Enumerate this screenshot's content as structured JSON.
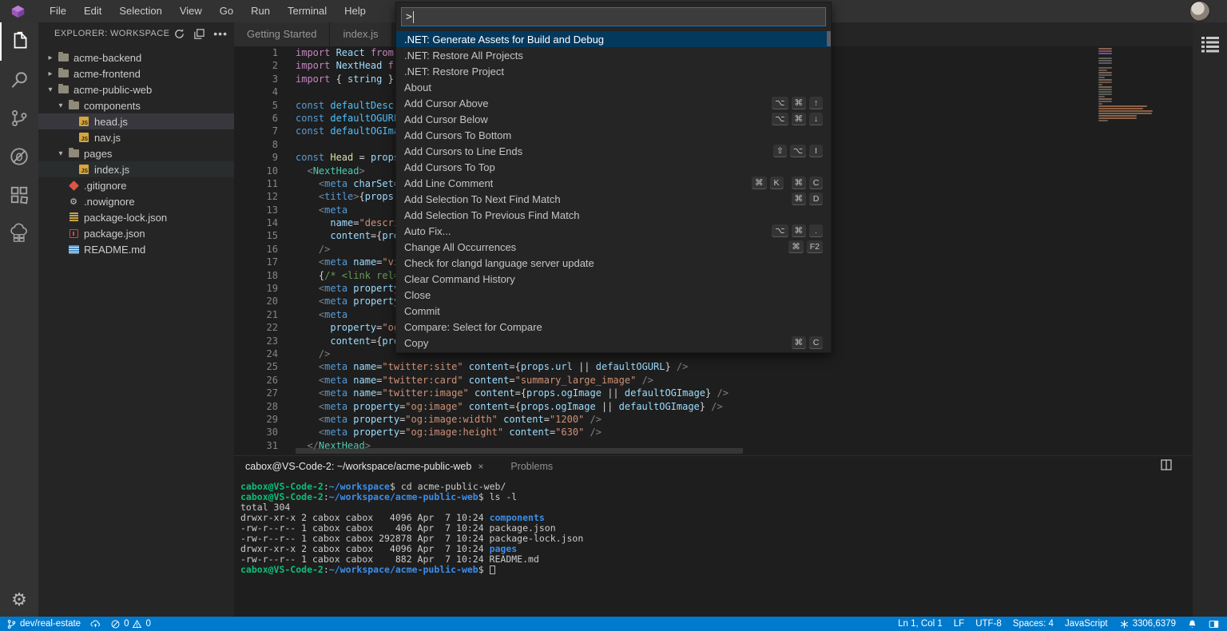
{
  "menu_bar": {
    "items": [
      "File",
      "Edit",
      "Selection",
      "View",
      "Go",
      "Run",
      "Terminal",
      "Help"
    ]
  },
  "activity_bar": {
    "items": [
      "explorer",
      "search",
      "source-control",
      "debug",
      "extensions",
      "remote"
    ],
    "active": "explorer",
    "bottom": "settings"
  },
  "explorer": {
    "header": "EXPLORER: WORKSPACE",
    "tree": [
      {
        "label": "acme-backend",
        "icon": "folder",
        "chevron": ">",
        "indent": 0
      },
      {
        "label": "acme-frontend",
        "icon": "folder",
        "chevron": ">",
        "indent": 0
      },
      {
        "label": "acme-public-web",
        "icon": "folder",
        "chevron": "v",
        "indent": 0
      },
      {
        "label": "components",
        "icon": "folder",
        "chevron": "v",
        "indent": 1
      },
      {
        "label": "head.js",
        "icon": "js",
        "indent": 2,
        "state": "selected"
      },
      {
        "label": "nav.js",
        "icon": "js",
        "indent": 2
      },
      {
        "label": "pages",
        "icon": "folder",
        "chevron": "v",
        "indent": 1
      },
      {
        "label": "index.js",
        "icon": "js",
        "indent": 2,
        "state": "subtle"
      },
      {
        "label": ".gitignore",
        "icon": "git",
        "indent": 1
      },
      {
        "label": ".nowignore",
        "icon": "gear",
        "indent": 1
      },
      {
        "label": "package-lock.json",
        "icon": "lock",
        "indent": 1
      },
      {
        "label": "package.json",
        "icon": "npm",
        "indent": 1
      },
      {
        "label": "README.md",
        "icon": "md",
        "indent": 1
      }
    ]
  },
  "tabs": [
    {
      "label": "Getting Started"
    },
    {
      "label": "index.js"
    }
  ],
  "editor": {
    "lines": [
      {
        "n": "1",
        "t": [
          [
            "kw",
            "import "
          ],
          [
            "id",
            "React "
          ],
          [
            "kw",
            "from "
          ],
          [
            "str",
            "'"
          ]
        ]
      },
      {
        "n": "2",
        "t": [
          [
            "kw",
            "import "
          ],
          [
            "id",
            "NextHead "
          ],
          [
            "kw",
            "fro"
          ]
        ]
      },
      {
        "n": "3",
        "t": [
          [
            "kw",
            "import "
          ],
          [
            "pl",
            "{ "
          ],
          [
            "id",
            "string "
          ],
          [
            "pl",
            "} "
          ],
          [
            "kw",
            "f"
          ]
        ]
      },
      {
        "n": "4",
        "t": []
      },
      {
        "n": "5",
        "t": [
          [
            "blue",
            "const "
          ],
          [
            "id2",
            "defaultDescri"
          ]
        ]
      },
      {
        "n": "6",
        "t": [
          [
            "blue",
            "const "
          ],
          [
            "id2",
            "defaultOGURL "
          ]
        ]
      },
      {
        "n": "7",
        "t": [
          [
            "blue",
            "const "
          ],
          [
            "id2",
            "defaultOGImag"
          ]
        ]
      },
      {
        "n": "8",
        "t": []
      },
      {
        "n": "9",
        "t": [
          [
            "blue",
            "const "
          ],
          [
            "fn",
            "Head "
          ],
          [
            "pl",
            "= "
          ],
          [
            "id",
            "props "
          ]
        ]
      },
      {
        "n": "10",
        "t": [
          [
            "pl",
            "  "
          ],
          [
            "br",
            "<"
          ],
          [
            "cmp",
            "NextHead"
          ],
          [
            "br",
            ">"
          ]
        ]
      },
      {
        "n": "11",
        "t": [
          [
            "pl",
            "    "
          ],
          [
            "br",
            "<"
          ],
          [
            "blue",
            "meta "
          ],
          [
            "id",
            "charSet"
          ],
          [
            "pl",
            "="
          ],
          [
            "str",
            "\""
          ]
        ]
      },
      {
        "n": "12",
        "t": [
          [
            "pl",
            "    "
          ],
          [
            "br",
            "<"
          ],
          [
            "blue",
            "title"
          ],
          [
            "br",
            ">"
          ],
          [
            "pl",
            "{"
          ],
          [
            "id",
            "props"
          ],
          [
            "pl",
            ".t"
          ]
        ]
      },
      {
        "n": "13",
        "t": [
          [
            "pl",
            "    "
          ],
          [
            "br",
            "<"
          ],
          [
            "blue",
            "meta"
          ]
        ]
      },
      {
        "n": "14",
        "t": [
          [
            "pl",
            "      "
          ],
          [
            "id",
            "name"
          ],
          [
            "pl",
            "="
          ],
          [
            "str",
            "\"descrip"
          ]
        ]
      },
      {
        "n": "15",
        "t": [
          [
            "pl",
            "      "
          ],
          [
            "id",
            "content"
          ],
          [
            "pl",
            "={"
          ],
          [
            "id",
            "prop"
          ]
        ]
      },
      {
        "n": "16",
        "t": [
          [
            "pl",
            "    "
          ],
          [
            "br",
            "/>"
          ]
        ]
      },
      {
        "n": "17",
        "t": [
          [
            "pl",
            "    "
          ],
          [
            "br",
            "<"
          ],
          [
            "blue",
            "meta "
          ],
          [
            "id",
            "name"
          ],
          [
            "pl",
            "="
          ],
          [
            "str",
            "\"vie"
          ]
        ]
      },
      {
        "n": "18",
        "t": [
          [
            "pl",
            "    {"
          ],
          [
            "cm",
            "/* <link rel=\""
          ]
        ]
      },
      {
        "n": "19",
        "t": [
          [
            "pl",
            "    "
          ],
          [
            "br",
            "<"
          ],
          [
            "blue",
            "meta "
          ],
          [
            "id",
            "property"
          ],
          [
            "pl",
            "="
          ]
        ]
      },
      {
        "n": "20",
        "t": [
          [
            "pl",
            "    "
          ],
          [
            "br",
            "<"
          ],
          [
            "blue",
            "meta "
          ],
          [
            "id",
            "property"
          ],
          [
            "pl",
            "="
          ]
        ]
      },
      {
        "n": "21",
        "t": [
          [
            "pl",
            "    "
          ],
          [
            "br",
            "<"
          ],
          [
            "blue",
            "meta"
          ]
        ]
      },
      {
        "n": "22",
        "t": [
          [
            "pl",
            "      "
          ],
          [
            "id",
            "property"
          ],
          [
            "pl",
            "="
          ],
          [
            "str",
            "\"og:"
          ]
        ]
      },
      {
        "n": "23",
        "t": [
          [
            "pl",
            "      "
          ],
          [
            "id",
            "content"
          ],
          [
            "pl",
            "={"
          ],
          [
            "id",
            "prop"
          ]
        ]
      },
      {
        "n": "24",
        "t": [
          [
            "pl",
            "    "
          ],
          [
            "br",
            "/>"
          ]
        ]
      },
      {
        "n": "25",
        "t": [
          [
            "pl",
            "    "
          ],
          [
            "br",
            "<"
          ],
          [
            "blue",
            "meta "
          ],
          [
            "id",
            "name"
          ],
          [
            "pl",
            "="
          ],
          [
            "str",
            "\"twitter:site\""
          ],
          [
            "pl",
            " "
          ],
          [
            "id",
            "content"
          ],
          [
            "pl",
            "={"
          ],
          [
            "id",
            "props.url"
          ],
          [
            "pl",
            " || "
          ],
          [
            "id",
            "defaultOGURL"
          ],
          [
            "pl",
            "} "
          ],
          [
            "br",
            "/>"
          ]
        ]
      },
      {
        "n": "26",
        "t": [
          [
            "pl",
            "    "
          ],
          [
            "br",
            "<"
          ],
          [
            "blue",
            "meta "
          ],
          [
            "id",
            "name"
          ],
          [
            "pl",
            "="
          ],
          [
            "str",
            "\"twitter:card\""
          ],
          [
            "pl",
            " "
          ],
          [
            "id",
            "content"
          ],
          [
            "pl",
            "="
          ],
          [
            "str",
            "\"summary_large_image\""
          ],
          [
            "pl",
            " "
          ],
          [
            "br",
            "/>"
          ]
        ]
      },
      {
        "n": "27",
        "t": [
          [
            "pl",
            "    "
          ],
          [
            "br",
            "<"
          ],
          [
            "blue",
            "meta "
          ],
          [
            "id",
            "name"
          ],
          [
            "pl",
            "="
          ],
          [
            "str",
            "\"twitter:image\""
          ],
          [
            "pl",
            " "
          ],
          [
            "id",
            "content"
          ],
          [
            "pl",
            "={"
          ],
          [
            "id",
            "props.ogImage"
          ],
          [
            "pl",
            " || "
          ],
          [
            "id",
            "defaultOGImage"
          ],
          [
            "pl",
            "} "
          ],
          [
            "br",
            "/>"
          ]
        ]
      },
      {
        "n": "28",
        "t": [
          [
            "pl",
            "    "
          ],
          [
            "br",
            "<"
          ],
          [
            "blue",
            "meta "
          ],
          [
            "id",
            "property"
          ],
          [
            "pl",
            "="
          ],
          [
            "str",
            "\"og:image\""
          ],
          [
            "pl",
            " "
          ],
          [
            "id",
            "content"
          ],
          [
            "pl",
            "={"
          ],
          [
            "id",
            "props.ogImage"
          ],
          [
            "pl",
            " || "
          ],
          [
            "id",
            "defaultOGImage"
          ],
          [
            "pl",
            "} "
          ],
          [
            "br",
            "/>"
          ]
        ]
      },
      {
        "n": "29",
        "t": [
          [
            "pl",
            "    "
          ],
          [
            "br",
            "<"
          ],
          [
            "blue",
            "meta "
          ],
          [
            "id",
            "property"
          ],
          [
            "pl",
            "="
          ],
          [
            "str",
            "\"og:image:width\""
          ],
          [
            "pl",
            " "
          ],
          [
            "id",
            "content"
          ],
          [
            "pl",
            "="
          ],
          [
            "str",
            "\"1200\""
          ],
          [
            "pl",
            " "
          ],
          [
            "br",
            "/>"
          ]
        ]
      },
      {
        "n": "30",
        "t": [
          [
            "pl",
            "    "
          ],
          [
            "br",
            "<"
          ],
          [
            "blue",
            "meta "
          ],
          [
            "id",
            "property"
          ],
          [
            "pl",
            "="
          ],
          [
            "str",
            "\"og:image:height\""
          ],
          [
            "pl",
            " "
          ],
          [
            "id",
            "content"
          ],
          [
            "pl",
            "="
          ],
          [
            "str",
            "\"630\""
          ],
          [
            "pl",
            " "
          ],
          [
            "br",
            "/>"
          ]
        ]
      },
      {
        "n": "31",
        "t": [
          [
            "pl",
            "  "
          ],
          [
            "br",
            "</"
          ],
          [
            "cmp",
            "NextHead"
          ],
          [
            "br",
            ">"
          ]
        ]
      }
    ]
  },
  "palette": {
    "input_value": ">",
    "items": [
      {
        "label": ".NET: Generate Assets for Build and Debug",
        "selected": true
      },
      {
        "label": ".NET: Restore All Projects"
      },
      {
        "label": ".NET: Restore Project"
      },
      {
        "label": "About"
      },
      {
        "label": "Add Cursor Above",
        "keys": [
          [
            "⌥",
            "⌘",
            "↑"
          ]
        ]
      },
      {
        "label": "Add Cursor Below",
        "keys": [
          [
            "⌥",
            "⌘",
            "↓"
          ]
        ]
      },
      {
        "label": "Add Cursors To Bottom"
      },
      {
        "label": "Add Cursors to Line Ends",
        "keys": [
          [
            "⇧",
            "⌥",
            "I"
          ]
        ]
      },
      {
        "label": "Add Cursors To Top"
      },
      {
        "label": "Add Line Comment",
        "keys": [
          [
            "⌘",
            "K"
          ],
          [
            "⌘",
            "C"
          ]
        ]
      },
      {
        "label": "Add Selection To Next Find Match",
        "keys": [
          [
            "⌘",
            "D"
          ]
        ]
      },
      {
        "label": "Add Selection To Previous Find Match"
      },
      {
        "label": "Auto Fix...",
        "keys": [
          [
            "⌥",
            "⌘",
            "."
          ]
        ]
      },
      {
        "label": "Change All Occurrences",
        "keys": [
          [
            "⌘",
            "F2"
          ]
        ]
      },
      {
        "label": "Check for clangd language server update"
      },
      {
        "label": "Clear Command History"
      },
      {
        "label": "Close"
      },
      {
        "label": "Commit"
      },
      {
        "label": "Compare: Select for Compare"
      },
      {
        "label": "Copy",
        "keys": [
          [
            "⌘",
            "C"
          ]
        ]
      }
    ]
  },
  "panel": {
    "terminal_tab": "cabox@VS-Code-2: ~/workspace/acme-public-web",
    "close_glyph": "×",
    "problems_tab": "Problems",
    "terminal_lines": [
      [
        [
          "g",
          "cabox@VS-Code-2"
        ],
        [
          "w",
          ":"
        ],
        [
          "b",
          "~/workspace"
        ],
        [
          "w",
          "$ cd acme-public-web/"
        ]
      ],
      [
        [
          "g",
          "cabox@VS-Code-2"
        ],
        [
          "w",
          ":"
        ],
        [
          "b",
          "~/workspace/acme-public-web"
        ],
        [
          "w",
          "$ ls -l"
        ]
      ],
      [
        [
          "w",
          "total 304"
        ]
      ],
      [
        [
          "w",
          "drwxr-xr-x 2 cabox cabox   4096 Apr  7 10:24 "
        ],
        [
          "dir",
          "components"
        ]
      ],
      [
        [
          "w",
          "-rw-r--r-- 1 cabox cabox    406 Apr  7 10:24 package.json"
        ]
      ],
      [
        [
          "w",
          "-rw-r--r-- 1 cabox cabox 292878 Apr  7 10:24 package-lock.json"
        ]
      ],
      [
        [
          "w",
          "drwxr-xr-x 2 cabox cabox   4096 Apr  7 10:24 "
        ],
        [
          "dir",
          "pages"
        ]
      ],
      [
        [
          "w",
          "-rw-r--r-- 1 cabox cabox    882 Apr  7 10:24 README.md"
        ]
      ],
      [
        [
          "g",
          "cabox@VS-Code-2"
        ],
        [
          "w",
          ":"
        ],
        [
          "b",
          "~/workspace/acme-public-web"
        ],
        [
          "w",
          "$ "
        ],
        [
          "cursor",
          ""
        ]
      ]
    ]
  },
  "status_bar": {
    "branch": "dev/real-estate",
    "errors": "0",
    "warnings": "0",
    "cursor_position": "Ln 1, Col 1",
    "eol": "LF",
    "encoding": "UTF-8",
    "indentation": "Spaces: 4",
    "language": "JavaScript",
    "ports": "3306,6379"
  }
}
